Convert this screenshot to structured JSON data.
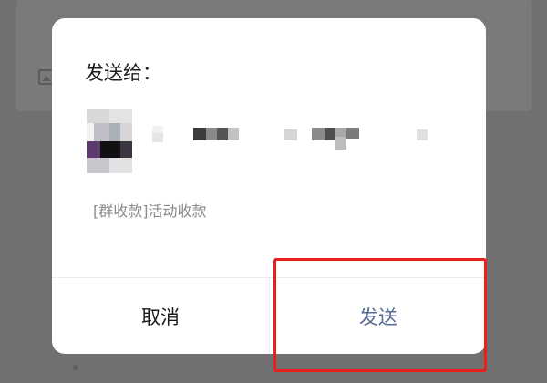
{
  "dialog": {
    "title": "发送给：",
    "preview_text": "[群收款]活动收款",
    "cancel_label": "取消",
    "send_label": "发送"
  },
  "recipient": {
    "avatar_icon": "pixelated-avatar-icon",
    "name_obscured": true
  },
  "colors": {
    "send_text": "#586b95",
    "highlight_border": "#e8211f",
    "overlay": "#707070"
  }
}
